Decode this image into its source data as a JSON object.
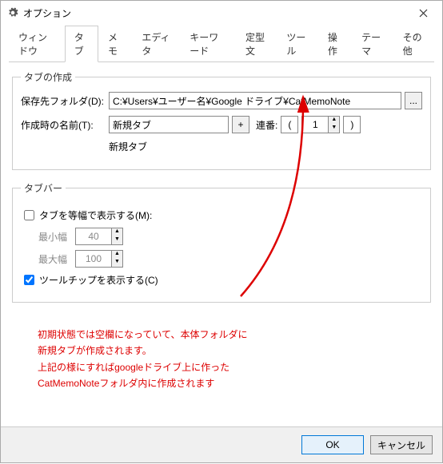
{
  "window": {
    "title": "オプション"
  },
  "tabs": [
    "ウィンドウ",
    "タブ",
    "メモ",
    "エディタ",
    "キーワード",
    "定型文",
    "ツール",
    "操作",
    "テーマ",
    "その他"
  ],
  "active_tab_index": 1,
  "group_create": {
    "legend": "タブの作成",
    "save_folder_label": "保存先フォルダ(D):",
    "save_folder_value": "C:¥Users¥ユーザー名¥Google ドライブ¥CatMemoNote",
    "browse_label": "...",
    "name_label": "作成時の名前(T):",
    "name_value": "新規タブ",
    "add_label": "+",
    "serial_label": "連番:",
    "serial_open": "(",
    "serial_value": "1",
    "serial_close": ")",
    "example": "新規タブ"
  },
  "group_tabbar": {
    "legend": "タブバー",
    "equal_width_label": "タブを等幅で表示する(M):",
    "equal_width_checked": false,
    "min_label": "最小幅",
    "min_value": "40",
    "max_label": "最大幅",
    "max_value": "100",
    "tooltip_label": "ツールチップを表示する(C)",
    "tooltip_checked": true
  },
  "annotation": {
    "line1": "初期状態では空欄になっていて、本体フォルダに",
    "line2": "新規タブが作成されます。",
    "line3": "上記の様にすればgoogleドライブ上に作った",
    "line4": "CatMemoNoteフォルダ内に作成されます"
  },
  "buttons": {
    "ok": "OK",
    "cancel": "キャンセル"
  }
}
